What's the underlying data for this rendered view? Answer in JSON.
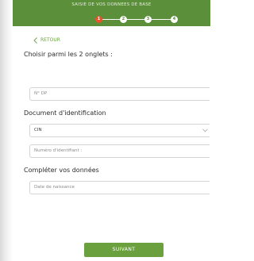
{
  "header": {
    "title": "SAISIE DE VOS DONNEES DE BASE",
    "steps": [
      "1",
      "2",
      "3",
      "4"
    ],
    "active_step": 1
  },
  "nav": {
    "back_label": "RETOUR",
    "back_icon": "chevron-left-icon"
  },
  "form": {
    "choose_heading": "Choisir parmi les 2 onglets :",
    "dp_placeholder": "N° DP",
    "id_doc_heading": "Document d'identification",
    "doc_type_value": "CIN",
    "id_number_placeholder": "Numéro d'identifiant :",
    "complete_heading": "Compléter vos données",
    "birthdate_placeholder": "Date de naissance"
  },
  "actions": {
    "submit_label": "SUIVANT"
  },
  "colors": {
    "header_green": "#5b8f3a",
    "accent_green": "#6aa13e",
    "active_step": "#e6562a"
  }
}
